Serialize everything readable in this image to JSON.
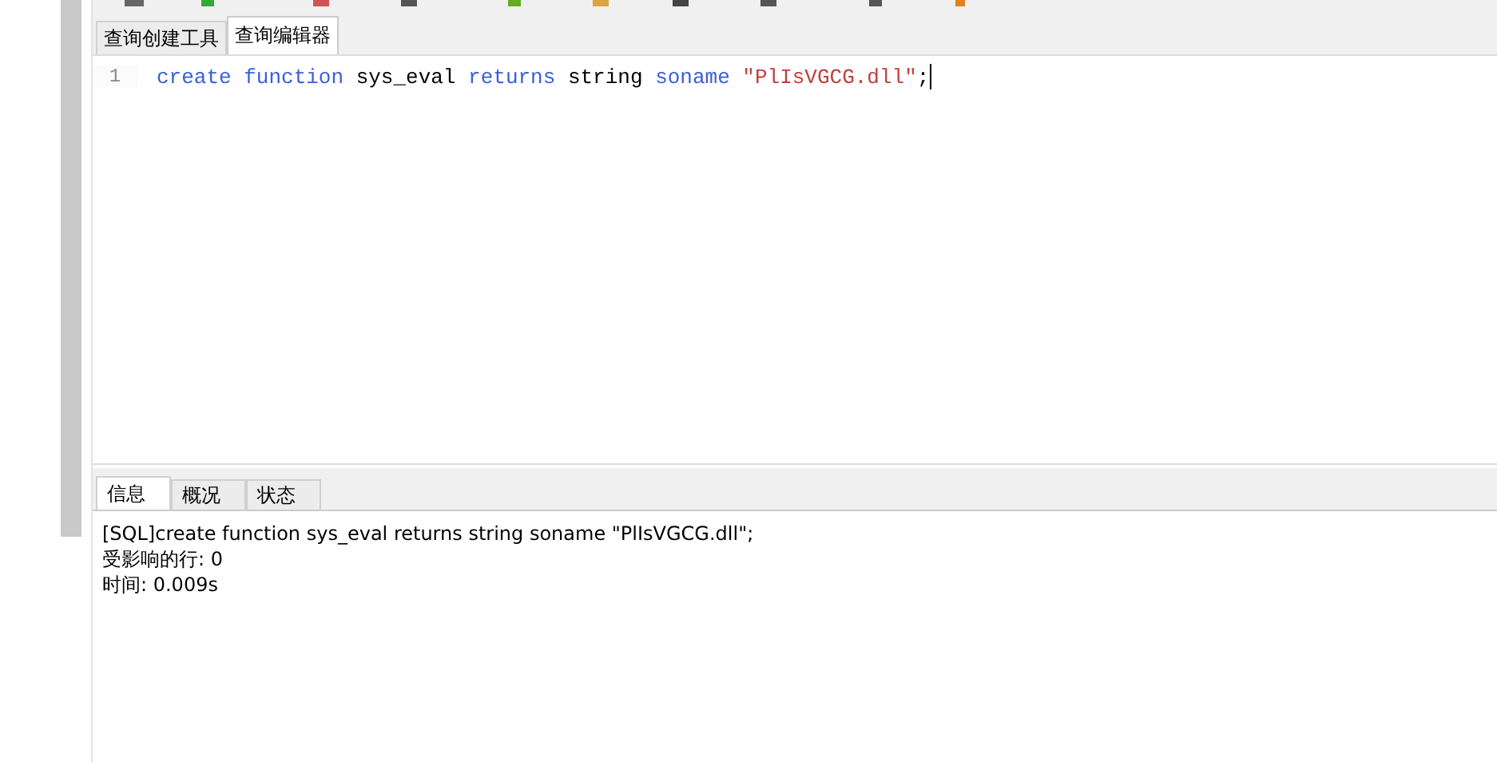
{
  "query_tabs": [
    {
      "label": "查询创建工具",
      "selected": false
    },
    {
      "label": "查询编辑器",
      "selected": true
    }
  ],
  "editor": {
    "lines": [
      {
        "number": "1",
        "tokens": [
          {
            "kind": "keyword",
            "text": "create"
          },
          {
            "kind": "keyword",
            "text": "function"
          },
          {
            "kind": "plain",
            "text": "sys_eval"
          },
          {
            "kind": "keyword",
            "text": "returns"
          },
          {
            "kind": "plain",
            "text": "string"
          },
          {
            "kind": "keyword",
            "text": "soname"
          },
          {
            "kind": "string",
            "text": "\"PlIsVGCG.dll\""
          },
          {
            "kind": "plain",
            "text": ";"
          }
        ]
      }
    ]
  },
  "result_tabs": [
    {
      "label": "信息",
      "selected": true
    },
    {
      "label": "概况",
      "selected": false
    },
    {
      "label": "状态",
      "selected": false
    }
  ],
  "messages": [
    "[SQL]create function sys_eval returns string soname \"PlIsVGCG.dll\";",
    "受影响的行: 0",
    "时间: 0.009s"
  ]
}
